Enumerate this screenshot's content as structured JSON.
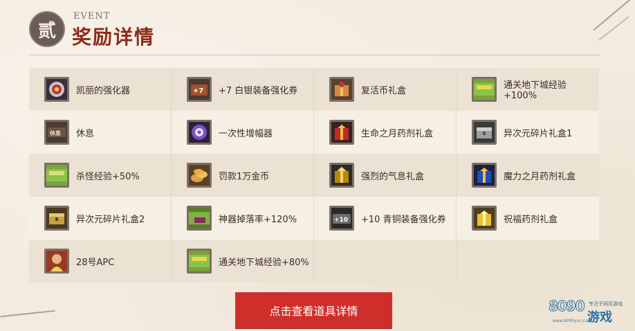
{
  "header": {
    "badge_char": "贰",
    "event_label": "EVENT",
    "title": "奖励详情"
  },
  "rewards": [
    {
      "label": "凯丽的强化器",
      "icon": "kelly-enhancer-icon"
    },
    {
      "label": "+7 白银装备强化券",
      "icon": "plus7-ticket-icon",
      "icon_text": "+7"
    },
    {
      "label": "复活币礼盒",
      "icon": "revive-coin-box-icon"
    },
    {
      "label": "通关地下城经验+100%",
      "icon": "exp-boost-icon"
    },
    {
      "label": "休息",
      "icon": "rest-icon",
      "icon_text": "休息"
    },
    {
      "label": "一次性增幅器",
      "icon": "amplifier-icon"
    },
    {
      "label": "生命之月药剂礼盒",
      "icon": "life-potion-box-icon"
    },
    {
      "label": "异次元碎片礼盒1",
      "icon": "dimension-box-icon"
    },
    {
      "label": "杀怪经验+50%",
      "icon": "kill-exp-icon"
    },
    {
      "label": "罚款1万金币",
      "icon": "gold-coins-icon"
    },
    {
      "label": "强烈的气息礼盒",
      "icon": "aura-box-icon"
    },
    {
      "label": "魔力之月药剂礼盒",
      "icon": "mana-potion-box-icon"
    },
    {
      "label": "异次元碎片礼盒2",
      "icon": "dimension-box-2-icon"
    },
    {
      "label": "神器掉落率+120%",
      "icon": "drop-rate-icon"
    },
    {
      "label": "+10 青铜装备强化券",
      "icon": "plus10-ticket-icon",
      "icon_text": "+10"
    },
    {
      "label": "祝福药剂礼盒",
      "icon": "blessing-box-icon"
    },
    {
      "label": "28号APC",
      "icon": "apc-portrait-icon"
    },
    {
      "label": "通关地下城经验+80%",
      "icon": "exp-boost-80-icon"
    },
    {
      "label": "",
      "icon": ""
    },
    {
      "label": "",
      "icon": ""
    }
  ],
  "button": {
    "label": "点击查看道具详情"
  },
  "logo": {
    "number": "8090",
    "tagline": "专注于网页游戏",
    "url": "www.8090yxs.com",
    "mark": "游戏"
  },
  "colors": {
    "title": "#8b2a1a",
    "button": "#cf2f2b",
    "row_dark": "#ebe2d4",
    "row_light": "#f6efe3"
  }
}
